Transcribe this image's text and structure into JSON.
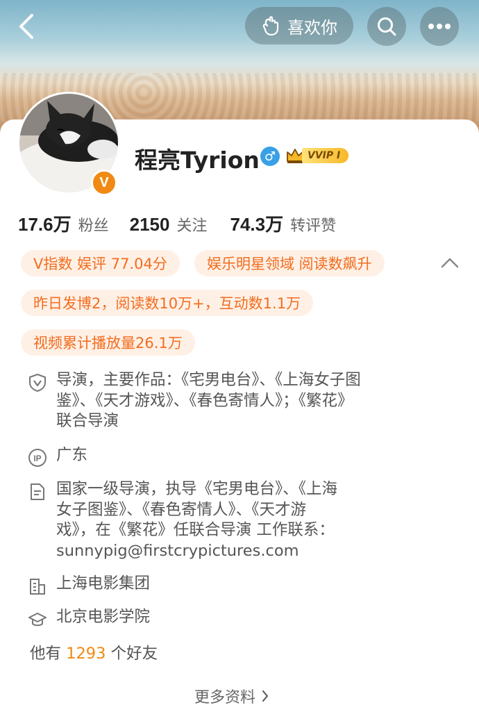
{
  "header": {
    "like_label": "喜欢你"
  },
  "profile": {
    "name": "程亮Tyrion",
    "verified_badge": "V",
    "vip_label": "VVIP I",
    "gender_symbol": "♂"
  },
  "stats": [
    {
      "num": "17.6万",
      "label": "粉丝"
    },
    {
      "num": "2150",
      "label": "关注"
    },
    {
      "num": "74.3万",
      "label": "转评赞"
    }
  ],
  "tags": [
    "V指数 娱评 77.04分",
    "娱乐明星领域 阅读数飙升",
    "昨日发博2，阅读数10万+，互动数1.1万",
    "视频累计播放量26.1万"
  ],
  "info": {
    "verification": [
      "导演，主要作品：《宅男电台》、《上海女子图",
      "鉴》、《天才游戏》、《春色寄情人》；《繁花》",
      "联合导演"
    ],
    "ip": "广东",
    "bio": [
      "国家一级导演，执导《宅男电台》、《上海",
      "女子图鉴》、《春色寄情人》、《天才游",
      "戏》，在《繁花》任联合导演 工作联系：",
      "sunnypig@firstcrypictures.com"
    ],
    "company": "上海电影集团",
    "school": "北京电影学院"
  },
  "friends": {
    "prefix": "他有",
    "count": "1293",
    "suffix": "个好友"
  },
  "more_info_label": "更多资料",
  "colors": {
    "accent": "#f08a13",
    "tag_bg": "#fff0e6",
    "tag_text": "#f26d1e"
  }
}
